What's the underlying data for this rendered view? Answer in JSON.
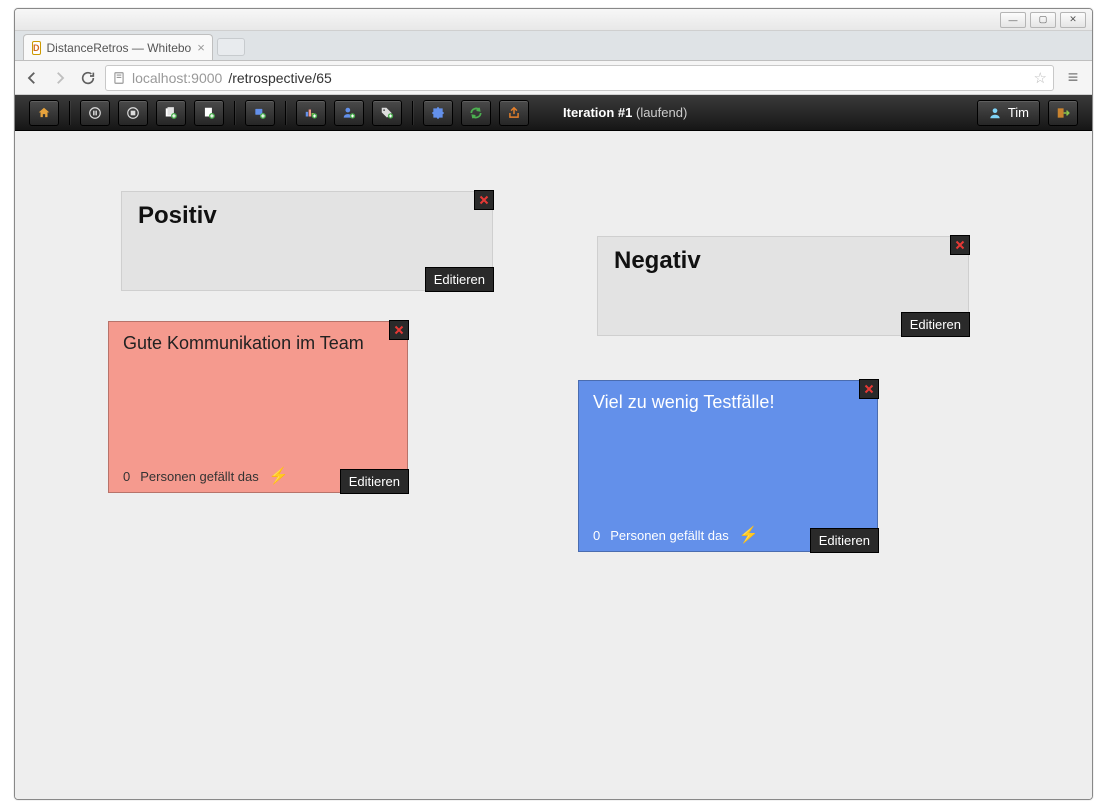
{
  "window": {
    "tab_title": "DistanceRetros — Whitebo",
    "url_host": "localhost",
    "url_port": ":9000",
    "url_path": "/retrospective/65"
  },
  "toolbar": {
    "iteration_label": "Iteration #1",
    "iteration_state": "(laufend)",
    "user_name": "Tim"
  },
  "panels": {
    "positive": {
      "title": "Positiv",
      "edit": "Editieren"
    },
    "negative": {
      "title": "Negativ",
      "edit": "Editieren"
    }
  },
  "cards": {
    "red": {
      "text": "Gute Kommunikation im Team",
      "likes_count": "0",
      "likes_label": "Personen gefällt das",
      "edit": "Editieren"
    },
    "blue": {
      "text": "Viel zu wenig Testfälle!",
      "likes_count": "0",
      "likes_label": "Personen gefällt das",
      "edit": "Editieren"
    }
  }
}
